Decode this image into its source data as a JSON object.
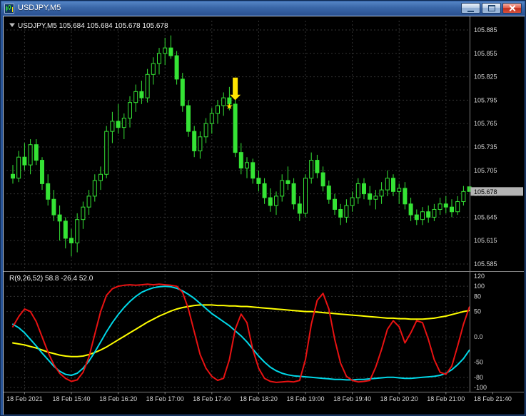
{
  "window": {
    "title": "USDJPY,M5",
    "controls": [
      "minimize",
      "maximize",
      "close"
    ]
  },
  "chart": {
    "header": {
      "symbol_label": "USDJPY,M5",
      "open": "105.684",
      "high": "105.684",
      "low": "105.678",
      "close": "105.678"
    }
  },
  "chart_data": {
    "type": "candlestick",
    "symbol": "USDJPY",
    "timeframe": "M5",
    "price_ticks": [
      "105.885",
      "105.855",
      "105.825",
      "105.795",
      "105.765",
      "105.735",
      "105.705",
      "105.675",
      "105.645",
      "105.615",
      "105.585"
    ],
    "current_price": "105.678",
    "time_ticks": [
      {
        "bar": 2,
        "label": "18 Feb 2021"
      },
      {
        "bar": 10,
        "label": "18 Feb 15:40"
      },
      {
        "bar": 18,
        "label": "18 Feb 16:20"
      },
      {
        "bar": 26,
        "label": "18 Feb 17:00"
      },
      {
        "bar": 34,
        "label": "18 Feb 17:40"
      },
      {
        "bar": 42,
        "label": "18 Feb 18:20"
      },
      {
        "bar": 50,
        "label": "18 Feb 19:00"
      },
      {
        "bar": 58,
        "label": "18 Feb 19:40"
      },
      {
        "bar": 66,
        "label": "18 Feb 20:20"
      },
      {
        "bar": 74,
        "label": "18 Feb 21:00"
      },
      {
        "bar": 82,
        "label": "18 Feb 21:40"
      }
    ],
    "candles": [
      [
        105.7,
        105.712,
        105.688,
        105.695
      ],
      [
        105.695,
        105.73,
        105.69,
        105.722
      ],
      [
        105.722,
        105.74,
        105.705,
        105.712
      ],
      [
        105.712,
        105.745,
        105.7,
        105.738
      ],
      [
        105.738,
        105.745,
        105.712,
        105.718
      ],
      [
        105.718,
        105.722,
        105.68,
        105.688
      ],
      [
        105.688,
        105.7,
        105.66,
        105.668
      ],
      [
        105.668,
        105.68,
        105.64,
        105.648
      ],
      [
        105.648,
        105.66,
        105.615,
        105.64
      ],
      [
        105.64,
        105.645,
        105.605,
        105.618
      ],
      [
        105.618,
        105.63,
        105.595,
        105.612
      ],
      [
        105.612,
        105.65,
        105.6,
        105.642
      ],
      [
        105.642,
        105.665,
        105.63,
        105.658
      ],
      [
        105.658,
        105.68,
        105.648,
        105.672
      ],
      [
        105.672,
        105.7,
        105.665,
        105.692
      ],
      [
        105.692,
        105.71,
        105.68,
        105.7
      ],
      [
        105.7,
        105.762,
        105.695,
        105.755
      ],
      [
        105.755,
        105.78,
        105.74,
        105.768
      ],
      [
        105.768,
        105.79,
        105.752,
        105.76
      ],
      [
        105.76,
        105.778,
        105.745,
        105.772
      ],
      [
        105.772,
        105.8,
        105.76,
        105.792
      ],
      [
        105.792,
        105.815,
        105.78,
        105.806
      ],
      [
        105.806,
        105.82,
        105.79,
        105.798
      ],
      [
        105.798,
        105.835,
        105.792,
        105.828
      ],
      [
        105.828,
        105.85,
        105.815,
        105.842
      ],
      [
        105.842,
        105.862,
        105.828,
        105.855
      ],
      [
        105.855,
        105.875,
        105.84,
        105.862
      ],
      [
        105.862,
        105.878,
        105.848,
        105.852
      ],
      [
        105.852,
        105.858,
        105.815,
        105.822
      ],
      [
        105.822,
        105.83,
        105.78,
        105.788
      ],
      [
        105.788,
        105.795,
        105.748,
        105.755
      ],
      [
        105.755,
        105.762,
        105.722,
        105.73
      ],
      [
        105.73,
        105.755,
        105.72,
        105.748
      ],
      [
        105.748,
        105.772,
        105.74,
        105.765
      ],
      [
        105.765,
        105.785,
        105.752,
        105.778
      ],
      [
        105.778,
        105.795,
        105.765,
        105.788
      ],
      [
        105.788,
        105.805,
        105.775,
        105.798
      ],
      [
        105.798,
        105.812,
        105.782,
        105.79
      ],
      [
        105.79,
        105.795,
        105.722,
        105.728
      ],
      [
        105.728,
        105.74,
        105.7,
        105.708
      ],
      [
        105.708,
        105.722,
        105.695,
        105.715
      ],
      [
        105.715,
        105.72,
        105.688,
        105.695
      ],
      [
        105.695,
        105.705,
        105.678,
        105.688
      ],
      [
        105.688,
        105.695,
        105.662,
        105.67
      ],
      [
        105.67,
        105.682,
        105.652,
        105.66
      ],
      [
        105.66,
        105.678,
        105.648,
        105.672
      ],
      [
        105.672,
        105.7,
        105.665,
        105.692
      ],
      [
        105.692,
        105.71,
        105.68,
        105.688
      ],
      [
        105.688,
        105.695,
        105.655,
        105.662
      ],
      [
        105.662,
        105.672,
        105.64,
        105.65
      ],
      [
        105.65,
        105.7,
        105.645,
        105.695
      ],
      [
        105.695,
        105.728,
        105.688,
        105.718
      ],
      [
        105.718,
        105.725,
        105.695,
        105.702
      ],
      [
        105.702,
        105.71,
        105.678,
        105.685
      ],
      [
        105.685,
        105.692,
        105.662,
        105.668
      ],
      [
        105.668,
        105.675,
        105.648,
        105.655
      ],
      [
        105.655,
        105.662,
        105.635,
        105.645
      ],
      [
        105.645,
        105.668,
        105.638,
        105.66
      ],
      [
        105.66,
        105.678,
        105.652,
        105.67
      ],
      [
        105.67,
        105.695,
        105.662,
        105.688
      ],
      [
        105.688,
        105.695,
        105.668,
        105.675
      ],
      [
        105.675,
        105.685,
        105.66,
        105.668
      ],
      [
        105.668,
        105.68,
        105.655,
        105.672
      ],
      [
        105.672,
        105.69,
        105.662,
        105.68
      ],
      [
        105.68,
        105.705,
        105.672,
        105.695
      ],
      [
        105.695,
        105.7,
        105.672,
        105.678
      ],
      [
        105.678,
        105.688,
        105.662,
        105.682
      ],
      [
        105.682,
        105.69,
        105.655,
        105.662
      ],
      [
        105.662,
        105.67,
        105.64,
        105.648
      ],
      [
        105.648,
        105.655,
        105.635,
        105.642
      ],
      [
        105.642,
        105.658,
        105.635,
        105.652
      ],
      [
        105.652,
        105.66,
        105.638,
        105.645
      ],
      [
        105.645,
        105.662,
        105.64,
        105.655
      ],
      [
        105.655,
        105.67,
        105.648,
        105.662
      ],
      [
        105.662,
        105.672,
        105.65,
        105.658
      ],
      [
        105.658,
        105.668,
        105.645,
        105.652
      ],
      [
        105.652,
        105.672,
        105.648,
        105.665
      ],
      [
        105.665,
        105.685,
        105.66,
        105.678
      ],
      [
        105.684,
        105.684,
        105.678,
        105.678
      ]
    ],
    "indicator": {
      "label": "R(9,26,52)",
      "current_values": [
        "58.8",
        "-26.4",
        "52.0"
      ],
      "ticks": [
        "120",
        "100",
        "80",
        "50",
        "0.0",
        "-50",
        "-80",
        "-100"
      ],
      "range": [
        -100,
        120
      ],
      "series": [
        {
          "name": "red",
          "color": "#e81212",
          "values": [
            20,
            40,
            55,
            50,
            30,
            0,
            -30,
            -55,
            -72,
            -82,
            -88,
            -85,
            -70,
            -40,
            5,
            50,
            82,
            95,
            100,
            102,
            103,
            102,
            103,
            104,
            103,
            104,
            103,
            102,
            100,
            88,
            55,
            10,
            -35,
            -62,
            -78,
            -86,
            -82,
            -45,
            15,
            45,
            28,
            -25,
            -62,
            -82,
            -88,
            -90,
            -89,
            -88,
            -89,
            -86,
            -45,
            25,
            72,
            86,
            55,
            -5,
            -52,
            -78,
            -86,
            -89,
            -88,
            -86,
            -60,
            -25,
            15,
            32,
            20,
            -12,
            8,
            32,
            28,
            -5,
            -45,
            -70,
            -74,
            -58,
            -18,
            25,
            58.8
          ]
        },
        {
          "name": "aqua",
          "color": "#00d8e8",
          "values": [
            25,
            18,
            8,
            -5,
            -18,
            -32,
            -45,
            -58,
            -68,
            -74,
            -76,
            -72,
            -62,
            -48,
            -30,
            -10,
            10,
            28,
            44,
            58,
            70,
            80,
            88,
            93,
            97,
            99,
            100,
            99,
            96,
            91,
            84,
            76,
            66,
            56,
            46,
            38,
            30,
            22,
            12,
            2,
            -10,
            -24,
            -38,
            -50,
            -60,
            -67,
            -72,
            -75,
            -77,
            -78,
            -79,
            -80,
            -81,
            -82,
            -83,
            -84,
            -84,
            -85,
            -85,
            -84,
            -84,
            -83,
            -82,
            -81,
            -80,
            -80,
            -81,
            -82,
            -82,
            -81,
            -80,
            -79,
            -78,
            -76,
            -72,
            -65,
            -55,
            -43,
            -26.4
          ]
        },
        {
          "name": "yellow",
          "color": "#ffff00",
          "values": [
            -12,
            -14,
            -16,
            -19,
            -22,
            -26,
            -30,
            -33,
            -36,
            -38,
            -39,
            -39,
            -38,
            -35,
            -31,
            -26,
            -20,
            -13,
            -6,
            1,
            8,
            15,
            22,
            29,
            35,
            41,
            46,
            51,
            55,
            58,
            60,
            62,
            63,
            63,
            63,
            62,
            62,
            61,
            61,
            60,
            60,
            59,
            58,
            57,
            56,
            55,
            54,
            53,
            52,
            51,
            50,
            50,
            49,
            48,
            47,
            46,
            45,
            44,
            43,
            42,
            41,
            40,
            39,
            38,
            37,
            37,
            36,
            36,
            35,
            35,
            35,
            36,
            37,
            39,
            41,
            44,
            47,
            50,
            52
          ]
        }
      ]
    },
    "marker": {
      "arrow_bar": 38,
      "arrow_top": 105.824,
      "arrow_neck": 105.802,
      "arrow_tip": 105.795,
      "star_bar": 37,
      "star_price": 105.787,
      "color": "#ffe400"
    },
    "style": {
      "bg": "#000000",
      "grid": "#333333",
      "candle_stroke": "#35e335",
      "bull_fill": "#000000",
      "axis_text": "#d6d6d6",
      "header_text": "#f0f0f0",
      "price_tag_bg": "#b4b4b4",
      "separator": "#7f7f7f"
    }
  }
}
